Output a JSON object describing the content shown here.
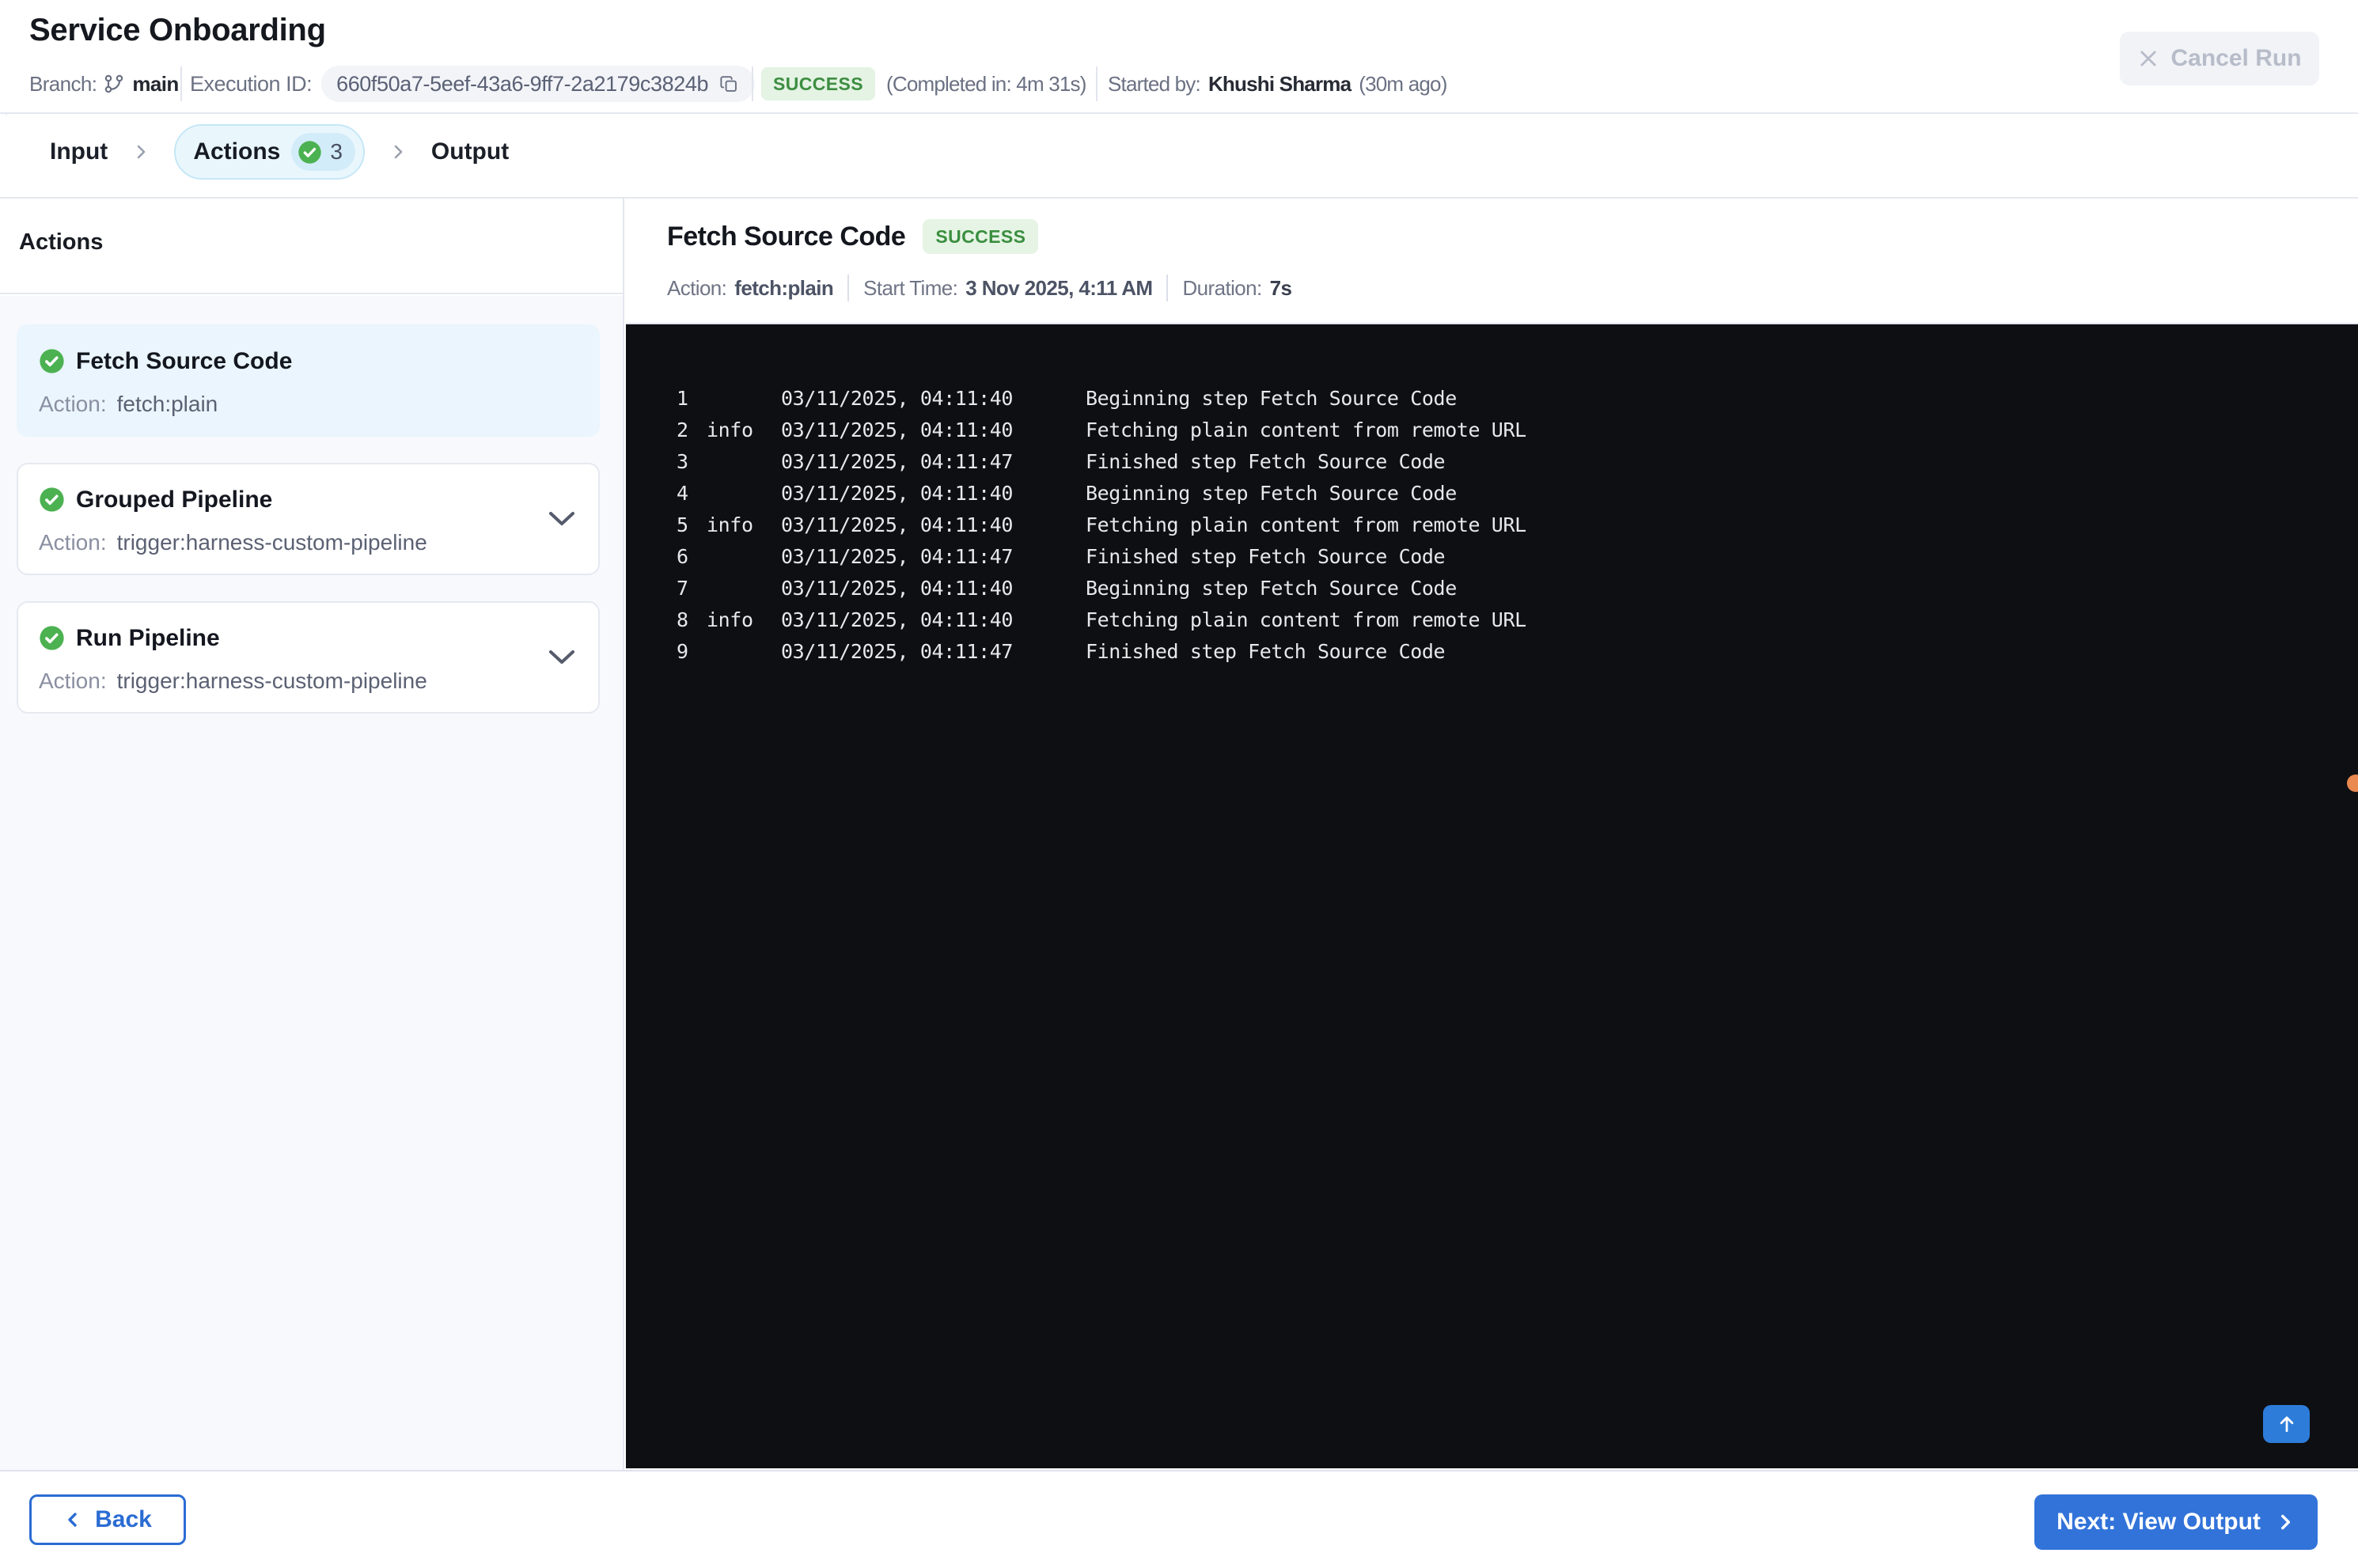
{
  "header": {
    "title": "Service Onboarding",
    "branch_label": "Branch:",
    "branch_value": "main",
    "execution_id_label": "Execution ID:",
    "execution_id": "660f50a7-5eef-43a6-9ff7-2a2179c3824b",
    "status": "SUCCESS",
    "completed_in": "(Completed in: 4m 31s)",
    "started_by_label": "Started by:",
    "started_by_name": "Khushi Sharma",
    "started_by_ago": "(30m ago)",
    "cancel_label": "Cancel Run"
  },
  "stepper": {
    "steps": [
      {
        "label": "Input"
      },
      {
        "label": "Actions",
        "count": "3",
        "active": true
      },
      {
        "label": "Output"
      }
    ]
  },
  "sidebar": {
    "heading": "Actions",
    "action_label": "Action:",
    "cards": [
      {
        "title": "Fetch Source Code",
        "action": "fetch:plain",
        "selected": true,
        "expandable": false
      },
      {
        "title": "Grouped Pipeline",
        "action": "trigger:harness-custom-pipeline",
        "selected": false,
        "expandable": true
      },
      {
        "title": "Run Pipeline",
        "action": "trigger:harness-custom-pipeline",
        "selected": false,
        "expandable": true
      }
    ]
  },
  "detail": {
    "title": "Fetch Source Code",
    "status": "SUCCESS",
    "action_label": "Action:",
    "action_value": "fetch:plain",
    "start_time_label": "Start Time:",
    "start_time_value": "3 Nov 2025, 4:11 AM",
    "duration_label": "Duration:",
    "duration_value": "7s"
  },
  "log": {
    "lines": [
      {
        "num": "1",
        "level": "",
        "time": "03/11/2025, 04:11:40",
        "message": "Beginning step Fetch Source Code"
      },
      {
        "num": "2",
        "level": "info",
        "time": "03/11/2025, 04:11:40",
        "message": "Fetching plain content from remote URL"
      },
      {
        "num": "3",
        "level": "",
        "time": "03/11/2025, 04:11:47",
        "message": "Finished step Fetch Source Code"
      },
      {
        "num": "4",
        "level": "",
        "time": "03/11/2025, 04:11:40",
        "message": "Beginning step Fetch Source Code"
      },
      {
        "num": "5",
        "level": "info",
        "time": "03/11/2025, 04:11:40",
        "message": "Fetching plain content from remote URL"
      },
      {
        "num": "6",
        "level": "",
        "time": "03/11/2025, 04:11:47",
        "message": "Finished step Fetch Source Code"
      },
      {
        "num": "7",
        "level": "",
        "time": "03/11/2025, 04:11:40",
        "message": "Beginning step Fetch Source Code"
      },
      {
        "num": "8",
        "level": "info",
        "time": "03/11/2025, 04:11:40",
        "message": "Fetching plain content from remote URL"
      },
      {
        "num": "9",
        "level": "",
        "time": "03/11/2025, 04:11:47",
        "message": "Finished step Fetch Source Code"
      }
    ]
  },
  "footer": {
    "back_label": "Back",
    "next_label": "Next: View Output"
  },
  "colors": {
    "accent_blue": "#2f72d8",
    "success_green": "#4cb151",
    "success_badge_bg": "#e4f3e3",
    "success_badge_text": "#3d8d41",
    "console_bg": "#0e0f12",
    "selected_card_bg": "#eaf5fd",
    "stepper_pill_bg": "#e9f7fd",
    "orange_dot": "#e9884f"
  }
}
